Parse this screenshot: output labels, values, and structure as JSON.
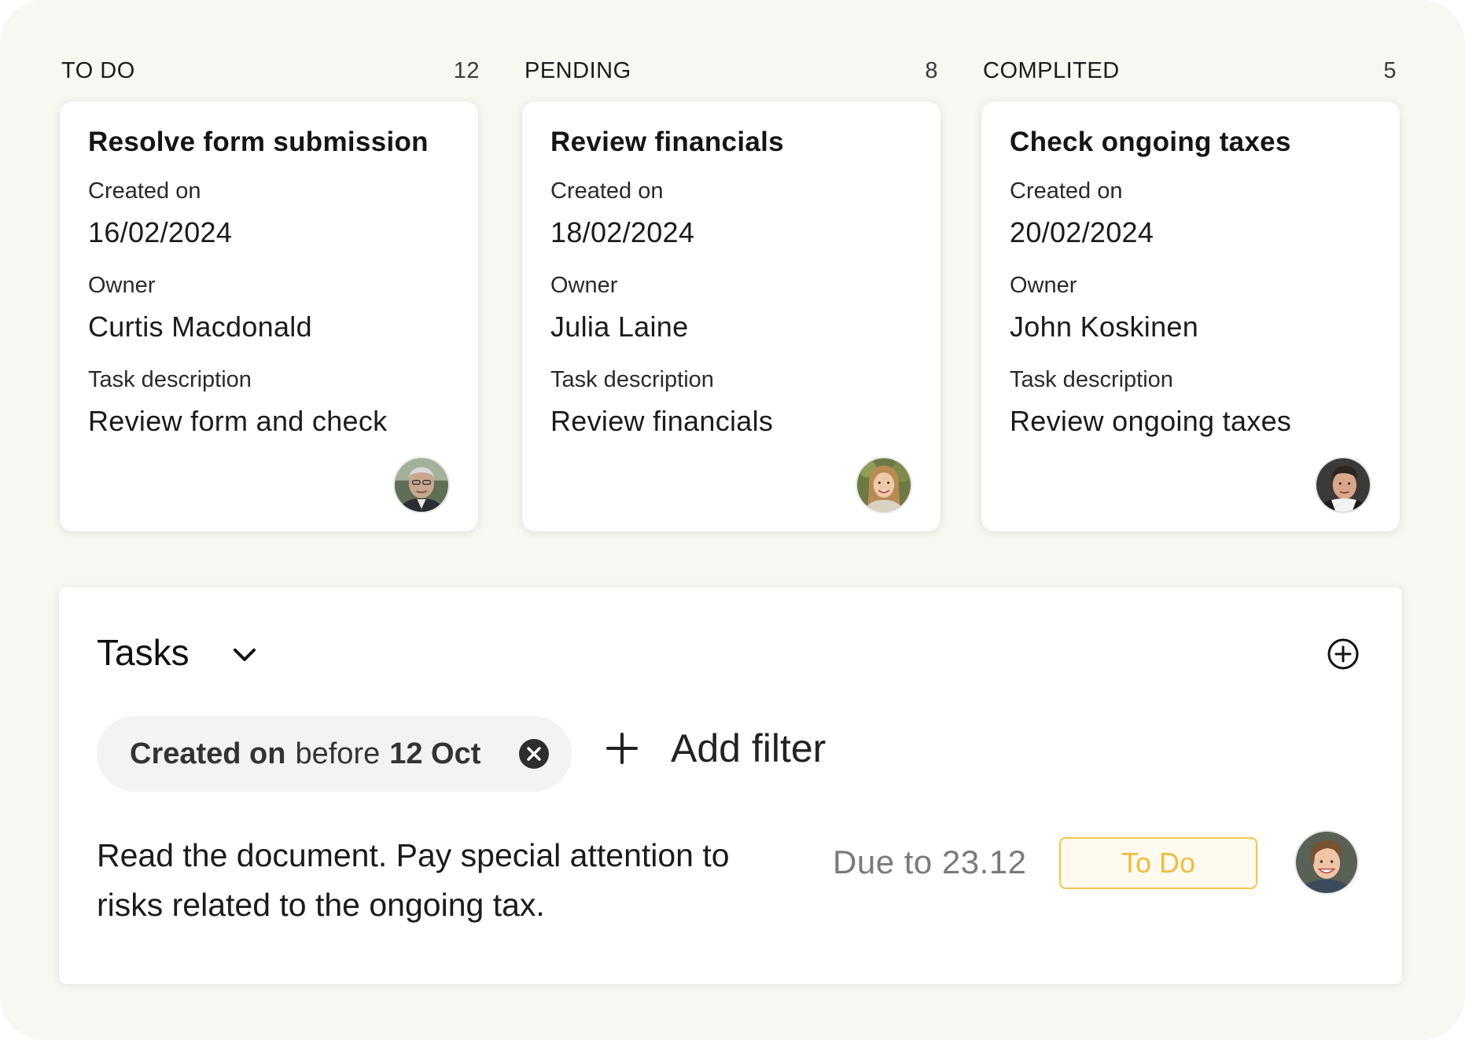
{
  "columns": [
    {
      "title": "TO DO",
      "count": "12",
      "card": {
        "title": "Resolve form submission",
        "created_label": "Created on",
        "created_value": "16/02/2024",
        "owner_label": "Owner",
        "owner_value": "Curtis Macdonald",
        "desc_label": "Task description",
        "desc_value": "Review form and check",
        "avatar_icon": "avatar-older-man"
      }
    },
    {
      "title": "PENDING",
      "count": "8",
      "card": {
        "title": "Review financials",
        "created_label": "Created on",
        "created_value": "18/02/2024",
        "owner_label": "Owner",
        "owner_value": "Julia Laine",
        "desc_label": "Task description",
        "desc_value": "Review financials",
        "avatar_icon": "avatar-woman"
      }
    },
    {
      "title": "COMPLITED",
      "count": "5",
      "card": {
        "title": "Check ongoing taxes",
        "created_label": "Created on",
        "created_value": "20/02/2024",
        "owner_label": "Owner",
        "owner_value": "John Koskinen",
        "desc_label": "Task description",
        "desc_value": "Review ongoing taxes",
        "avatar_icon": "avatar-young-man"
      }
    }
  ],
  "tasks_panel": {
    "title": "Tasks",
    "chevron_icon": "chevron-down-icon",
    "add_icon": "plus-circle-icon",
    "filter_chip": {
      "field": "Created on",
      "operator": "before",
      "value": "12 Oct",
      "remove_icon": "close-circle-icon"
    },
    "add_filter_label": "Add filter",
    "add_filter_icon": "plus-icon",
    "task": {
      "description": "Read the document. Pay special attention to risks related to the ongoing tax.",
      "due": "Due to 23.12",
      "status": "To Do",
      "avatar_icon": "avatar-young-man-smiling"
    }
  },
  "colors": {
    "background": "#f6f8f1",
    "status_border": "#f2c54a",
    "status_text": "#efbd40"
  }
}
